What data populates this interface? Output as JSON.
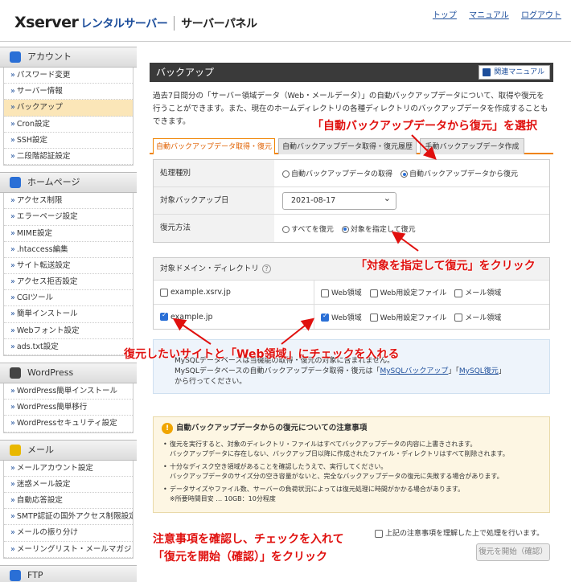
{
  "header": {
    "brand": "Xserver",
    "product": "レンタルサーバー",
    "panel": "サーバーパネル",
    "links": [
      "トップ",
      "マニュアル",
      "ログアウト"
    ]
  },
  "sidebar": [
    {
      "title": "アカウント",
      "color": "#2a6fd6",
      "items": [
        "パスワード変更",
        "サーバー情報",
        "バックアップ",
        "Cron設定",
        "SSH設定",
        "二段階認証設定"
      ],
      "active": 2
    },
    {
      "title": "ホームページ",
      "color": "#2a6fd6",
      "items": [
        "アクセス制限",
        "エラーページ設定",
        "MIME設定",
        ".htaccess編集",
        "サイト転送設定",
        "アクセス拒否設定",
        "CGIツール",
        "簡単インストール",
        "Webフォント設定",
        "ads.txt設定"
      ]
    },
    {
      "title": "WordPress",
      "color": "#444",
      "items": [
        "WordPress簡単インストール",
        "WordPress簡単移行",
        "WordPressセキュリティ設定"
      ]
    },
    {
      "title": "メール",
      "color": "#e9b800",
      "items": [
        "メールアカウント設定",
        "迷惑メール設定",
        "自動応答設定",
        "SMTP認証の国外アクセス制限設定",
        "メールの振り分け",
        "メーリングリスト・メールマガジン"
      ]
    },
    {
      "title": "FTP",
      "color": "#2a6fd6",
      "items": []
    }
  ],
  "main": {
    "title": "バックアップ",
    "manual": "関連マニュアル",
    "intro": "過去7日間分の「サーバー領域データ（Web・メールデータ）」の自動バックアップデータについて、取得や復元を行うことができます。また、現在のホームディレクトリの各種ディレクトリのバックアップデータを作成することもできます。",
    "tabs": [
      "自動バックアップデータ取得・復元",
      "自動バックアップデータ取得・復元履歴",
      "手動バックアップデータ作成"
    ],
    "form": {
      "type_label": "処理種別",
      "type_opt1": "自動バックアップデータの取得",
      "type_opt2": "自動バックアップデータから復元",
      "date_label": "対象バックアップ日",
      "date_value": "2021-08-17",
      "method_label": "復元方法",
      "method_opt1": "すべてを復元",
      "method_opt2": "対象を指定して復元"
    },
    "domain": {
      "header": "対象ドメイン・ディレクトリ",
      "rows": [
        {
          "name": "example.xsrv.jp",
          "checked": false
        },
        {
          "name": "example.jp",
          "checked": true
        }
      ],
      "web": "Web領域",
      "webconf": "Web用設定ファイル",
      "mail": "メール領域"
    },
    "info": {
      "line1": "MySQLデータベースは当機能の取得・復元の対象に含まれません。",
      "line2a": "MySQLデータベースの自動バックアップデータ取得・復元は「",
      "link1": "MySQLバックアップ",
      "line2b": "」「",
      "link2": "MySQL復元",
      "line2c": "」",
      "line3": "から行ってください。"
    },
    "warning": {
      "title": "自動バックアップデータからの復元についての注意事項",
      "b1a": "復元を実行すると、対象のディレクトリ・ファイルはすべてバックアップデータの内容に上書きされます。",
      "b1b": "バックアップデータに存在しない、バックアップ日以降に作成されたファイル・ディレクトリはすべて削除されます。",
      "b2a": "十分なディスク空き領域があることを確認したうえで、実行してください。",
      "b2b": "バックアップデータのサイズ分の空き容量がないと、完全なバックアップデータの復元に失敗する場合があります。",
      "b3a": "データサイズやファイル数、サーバーの負荷状況によっては復元処理に時間がかかる場合があります。",
      "b3b": "※所要時間目安 … 10GB：10分程度"
    },
    "agree": "上記の注意事項を理解した上で処理を行います。",
    "start": "復元を開始（確認）"
  },
  "annotations": {
    "a1": "「自動バックアップデータから復元」を選択",
    "a2": "「対象を指定して復元」をクリック",
    "a3": "復元したいサイトと「Web領域」にチェックを入れる",
    "a4": "注意事項を確認し、チェックを入れて",
    "a5": "「復元を開始（確認）」をクリック"
  },
  "colors": {
    "accent": "#f08300",
    "annotation": "#e0100e",
    "link": "#1d4e9b"
  }
}
